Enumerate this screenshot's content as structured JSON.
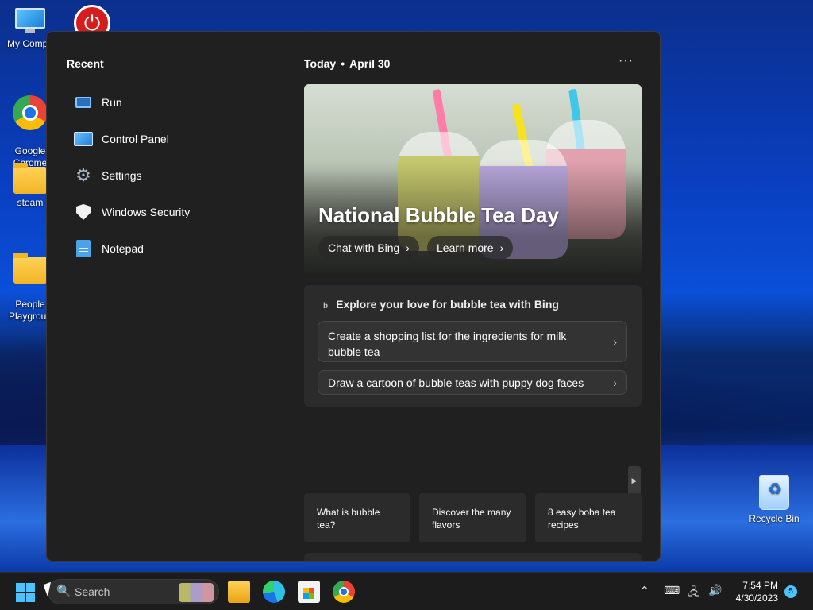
{
  "desktop": {
    "icons": [
      {
        "label": "My Compu",
        "icon": "monitor-icon"
      },
      {
        "label": "Google\nChrome",
        "icon": "chrome-icon"
      },
      {
        "label": "steam",
        "icon": "folder-icon"
      },
      {
        "label": "People\nPlaygroun",
        "icon": "folder-icon"
      },
      {
        "label": "Recycle Bin",
        "icon": "recycle-bin-icon"
      }
    ]
  },
  "start_menu": {
    "recent_title": "Recent",
    "recent_items": [
      {
        "label": "Run",
        "icon": "run-icon"
      },
      {
        "label": "Control Panel",
        "icon": "control-panel-icon"
      },
      {
        "label": "Settings",
        "icon": "gear-icon"
      },
      {
        "label": "Windows Security",
        "icon": "shield-icon"
      },
      {
        "label": "Notepad",
        "icon": "notepad-icon"
      }
    ],
    "today_label": "Today",
    "separator": "•",
    "date": "April 30",
    "more_label": "···",
    "hero": {
      "title": "National Bubble Tea Day",
      "chat_button": "Chat with Bing",
      "learn_button": "Learn more"
    },
    "explore": {
      "bing_glyph": "b",
      "title": "Explore your love for bubble tea with Bing",
      "suggestions": [
        "Create a shopping list for the ingredients for milk bubble tea",
        "Draw a cartoon of bubble teas with puppy dog faces"
      ]
    },
    "cards": [
      "What is bubble tea?",
      "Discover the many flavors",
      "8 easy boba tea recipes"
    ]
  },
  "taskbar": {
    "search_placeholder": "Search",
    "apps": [
      "file-explorer-icon",
      "edge-icon",
      "store-icon",
      "chrome-icon"
    ],
    "tray": {
      "chevron": "⌃",
      "keyboard": "⌨",
      "network": "🖧",
      "volume": "🔊"
    },
    "time": "7:54 PM",
    "date": "4/30/2023",
    "notification_count": "5"
  },
  "colors": {
    "accent": "#4cc2ff",
    "menu_bg": "#202020"
  }
}
